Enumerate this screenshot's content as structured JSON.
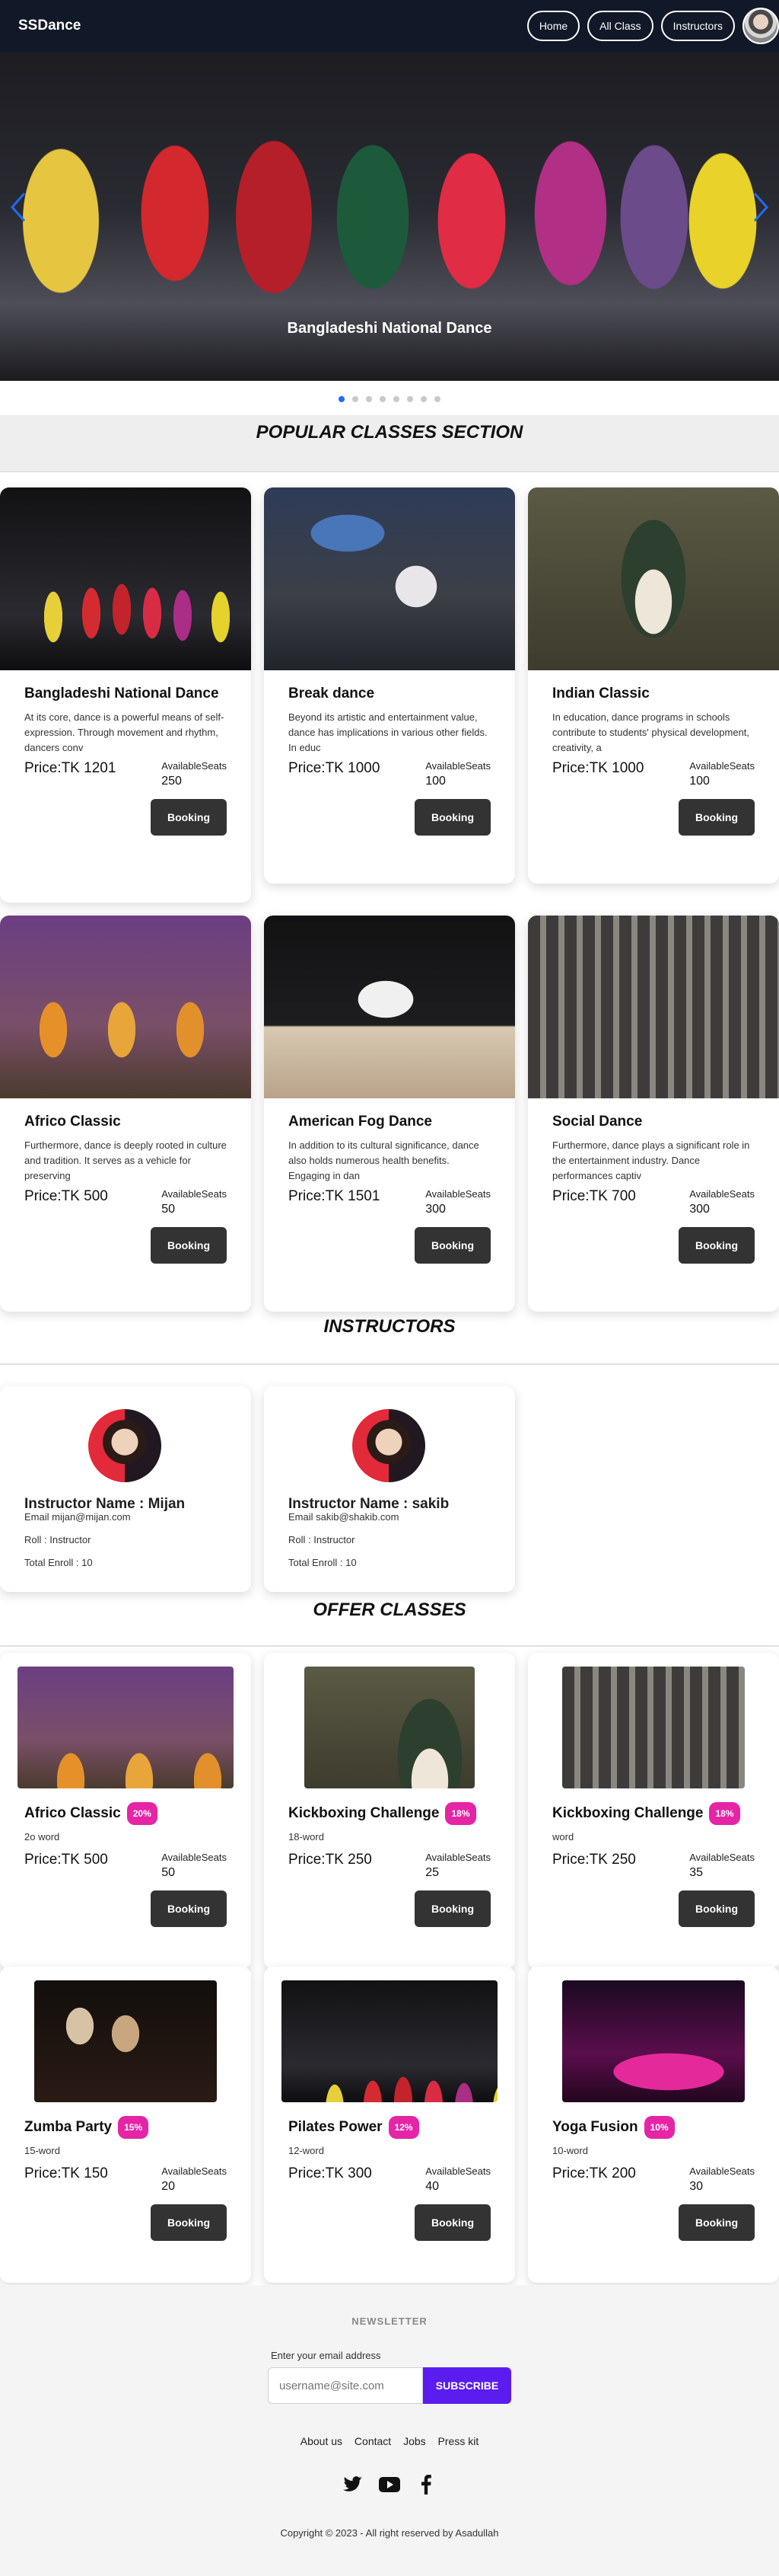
{
  "navbar": {
    "brand": "SSDance",
    "links": [
      "Home",
      "All Class",
      "Instructors"
    ]
  },
  "hero": {
    "caption": "Bangladeshi National Dance",
    "prev_icon": "chevron-left-icon",
    "next_icon": "chevron-right-icon",
    "slide_count": 8,
    "active_slide": 1
  },
  "popular": {
    "title": "POPULAR CLASSES SECTION",
    "classes": [
      {
        "name": "Bangladeshi National Dance",
        "desc": "At its core, dance is a powerful means of self-expression. Through movement and rhythm, dancers conv",
        "price": "Price:TK 1201",
        "seats_label": "AvailableSeats",
        "seats": "250",
        "button": "Booking"
      },
      {
        "name": "Break dance",
        "desc": "Beyond its artistic and entertainment value, dance has implications in various other fields. In educ",
        "price": "Price:TK 1000",
        "seats_label": "AvailableSeats",
        "seats": "100",
        "button": "Booking"
      },
      {
        "name": "Indian Classic",
        "desc": "In education, dance programs in schools contribute to students' physical development, creativity, a",
        "price": "Price:TK 1000",
        "seats_label": "AvailableSeats",
        "seats": "100",
        "button": "Booking"
      },
      {
        "name": "Africo Classic",
        "desc": "Furthermore, dance is deeply rooted in culture and tradition. It serves as a vehicle for preserving",
        "price": "Price:TK 500",
        "seats_label": "AvailableSeats",
        "seats": "50",
        "button": "Booking"
      },
      {
        "name": "American Fog Dance",
        "desc": "In addition to its cultural significance, dance also holds numerous health benefits. Engaging in dan",
        "price": "Price:TK 1501",
        "seats_label": "AvailableSeats",
        "seats": "300",
        "button": "Booking"
      },
      {
        "name": "Social Dance",
        "desc": "Furthermore, dance plays a significant role in the entertainment industry. Dance performances captiv",
        "price": "Price:TK 700",
        "seats_label": "AvailableSeats",
        "seats": "300",
        "button": "Booking"
      }
    ]
  },
  "instructors": {
    "title": "INSTRUCTORS",
    "items": [
      {
        "name": "Instructor Name : Mijan",
        "email": "Email mijan@mijan.com",
        "roll": "Roll : Instructor",
        "enroll": "Total Enroll : 10"
      },
      {
        "name": "Instructor Name : sakib",
        "email": "Email sakib@shakib.com",
        "roll": "Roll : Instructor",
        "enroll": "Total Enroll : 10"
      }
    ]
  },
  "offers": {
    "title": "OFFER CLASSES",
    "items": [
      {
        "name": "Africo Classic",
        "badge": "20%",
        "word": "2o word",
        "price": "Price:TK 500",
        "seats_label": "AvailableSeats",
        "seats": "50",
        "button": "Booking"
      },
      {
        "name": "Kickboxing Challenge",
        "badge": "18%",
        "word": "18-word",
        "price": "Price:TK 250",
        "seats_label": "AvailableSeats",
        "seats": "25",
        "button": "Booking"
      },
      {
        "name": "Kickboxing Challenge",
        "badge": "18%",
        "word": "word",
        "price": "Price:TK 250",
        "seats_label": "AvailableSeats",
        "seats": "35",
        "button": "Booking"
      },
      {
        "name": "Zumba Party",
        "badge": "15%",
        "word": "15-word",
        "price": "Price:TK 150",
        "seats_label": "AvailableSeats",
        "seats": "20",
        "button": "Booking"
      },
      {
        "name": "Pilates Power",
        "badge": "12%",
        "word": "12-word",
        "price": "Price:TK 300",
        "seats_label": "AvailableSeats",
        "seats": "40",
        "button": "Booking"
      },
      {
        "name": "Yoga Fusion",
        "badge": "10%",
        "word": "10-word",
        "price": "Price:TK 200",
        "seats_label": "AvailableSeats",
        "seats": "30",
        "button": "Booking"
      }
    ]
  },
  "newsletter": {
    "label": "NEWSLETTER",
    "prompt": "Enter your email address",
    "placeholder": "username@site.com",
    "button": "SUBSCRIBE"
  },
  "footer": {
    "links": [
      "About us",
      "Contact",
      "Jobs",
      "Press kit"
    ],
    "social_icons": [
      "twitter-icon",
      "youtube-icon",
      "facebook-icon"
    ],
    "copyright": "Copyright © 2023 - All right reserved by Asadullah"
  }
}
